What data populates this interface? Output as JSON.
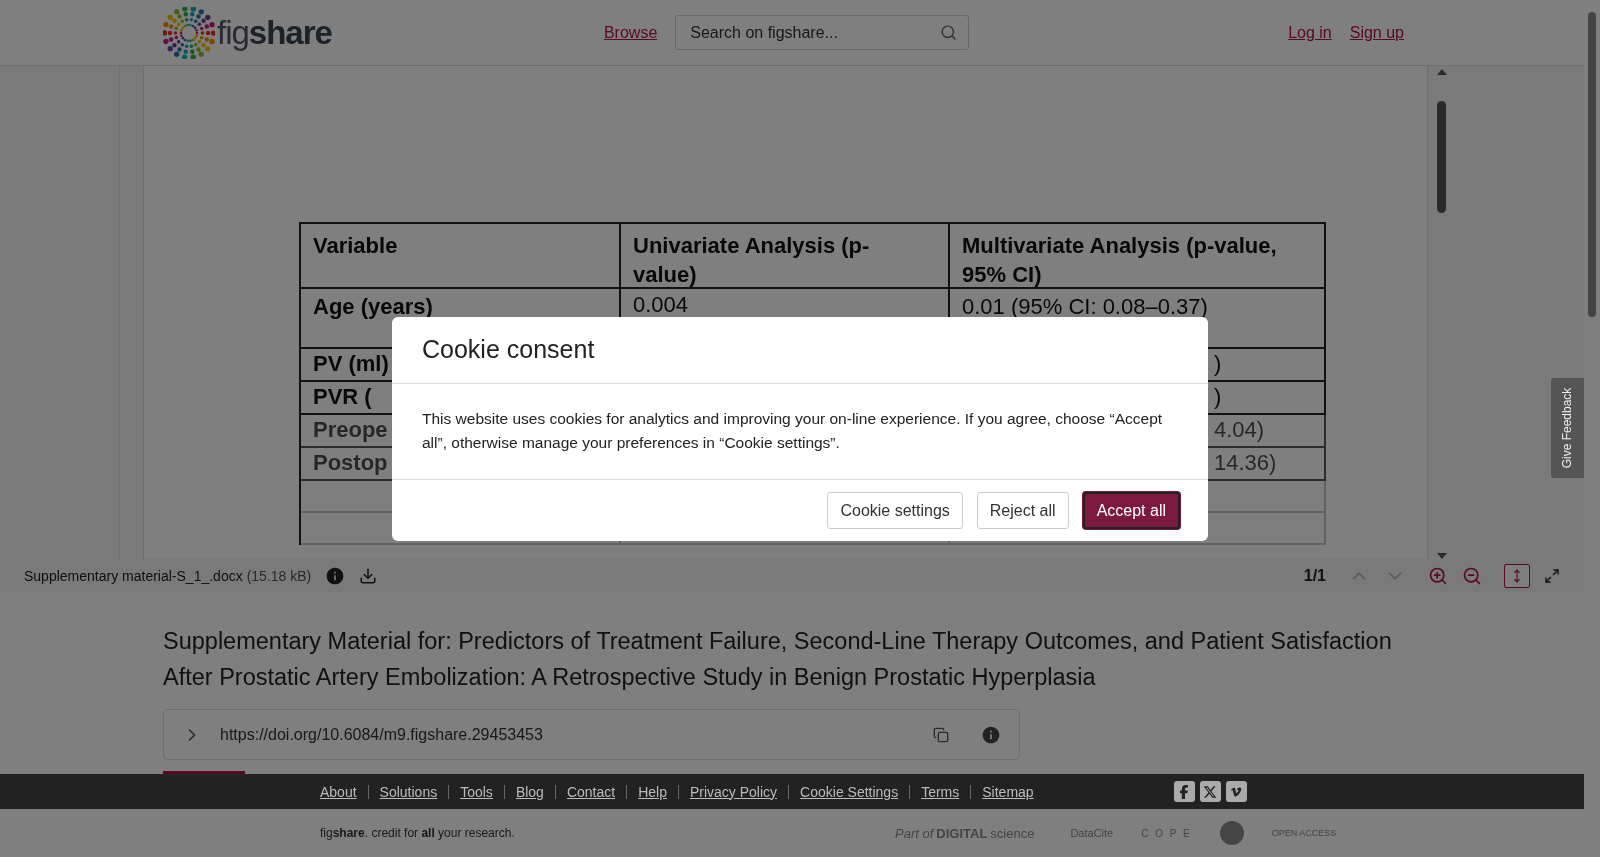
{
  "header": {
    "logo": "fig**share**",
    "nav_link": "Browse",
    "search": {
      "placeholder": "Search on figshare..."
    },
    "auth_links": [
      "Log in",
      "Sign up"
    ]
  },
  "preview": {
    "columns": [
      "Variable",
      "Univariate Analysis (p-value)",
      "Multivariate Analysis (p-value, 95% CI)"
    ],
    "rows": [
      {
        "variable": "Age (years)",
        "univariate": "0.004",
        "multivariate": "0.01 (95% CI: 0.08–0.37)"
      },
      {
        "variable": "PV (ml)",
        "multivariate_tail": ")"
      },
      {
        "variable": "PVR (",
        "multivariate_tail": ")"
      },
      {
        "variable": "Preope",
        "multivariate_tail": "4.04)"
      },
      {
        "variable": "Postop",
        "multivariate_tail": "14.36)"
      }
    ]
  },
  "viewer_toolbar": {
    "file_name": "Supplementary material-S_1_.docx",
    "file_size": "(15.18 kB)",
    "page": "1/1",
    "prev_disabled": true,
    "next_disabled": true,
    "fit_height_selected": true
  },
  "item": {
    "title": "Supplementary Material for: Predictors of Treatment Failure, Second-Line Therapy Outcomes, and Patient Satisfaction After Prostatic Artery Embolization: A Retrospective Study in Benign Prostatic Hyperplasia",
    "doi": "https://doi.org/10.6084/m9.figshare.29453453"
  },
  "footer": {
    "links": [
      "About",
      "Solutions",
      "Tools",
      "Blog",
      "Contact",
      "Help",
      "Privacy Policy",
      "Cookie Settings",
      "Terms",
      "Sitemap"
    ],
    "social": [
      {
        "kind": "facebook"
      },
      {
        "kind": "x"
      },
      {
        "kind": "vimeo"
      }
    ],
    "tagline": "fig**share**. credit for **all** your research.",
    "partners": [
      {
        "kind": "digital-science",
        "text": "*Part of* **DIGITAL**science"
      },
      {
        "kind": "datacite",
        "text": "DataCite"
      },
      {
        "kind": "cope",
        "text": "C O P E"
      },
      {
        "kind": "badge"
      },
      {
        "kind": "open-access",
        "text": "OPEN ACCESS"
      }
    ]
  },
  "feedback_tab": "Give Feedback",
  "cookie_dialog": {
    "title": "Cookie consent",
    "message": "This website uses cookies for analytics and improving your on-line experience. If you agree, choose “Accept all”, otherwise manage your preferences in “Cookie settings”.",
    "buttons": [
      {
        "label": "Cookie settings",
        "kind": "secondary"
      },
      {
        "label": "Reject all",
        "kind": "secondary"
      },
      {
        "label": "Accept all",
        "kind": "primary"
      }
    ]
  }
}
